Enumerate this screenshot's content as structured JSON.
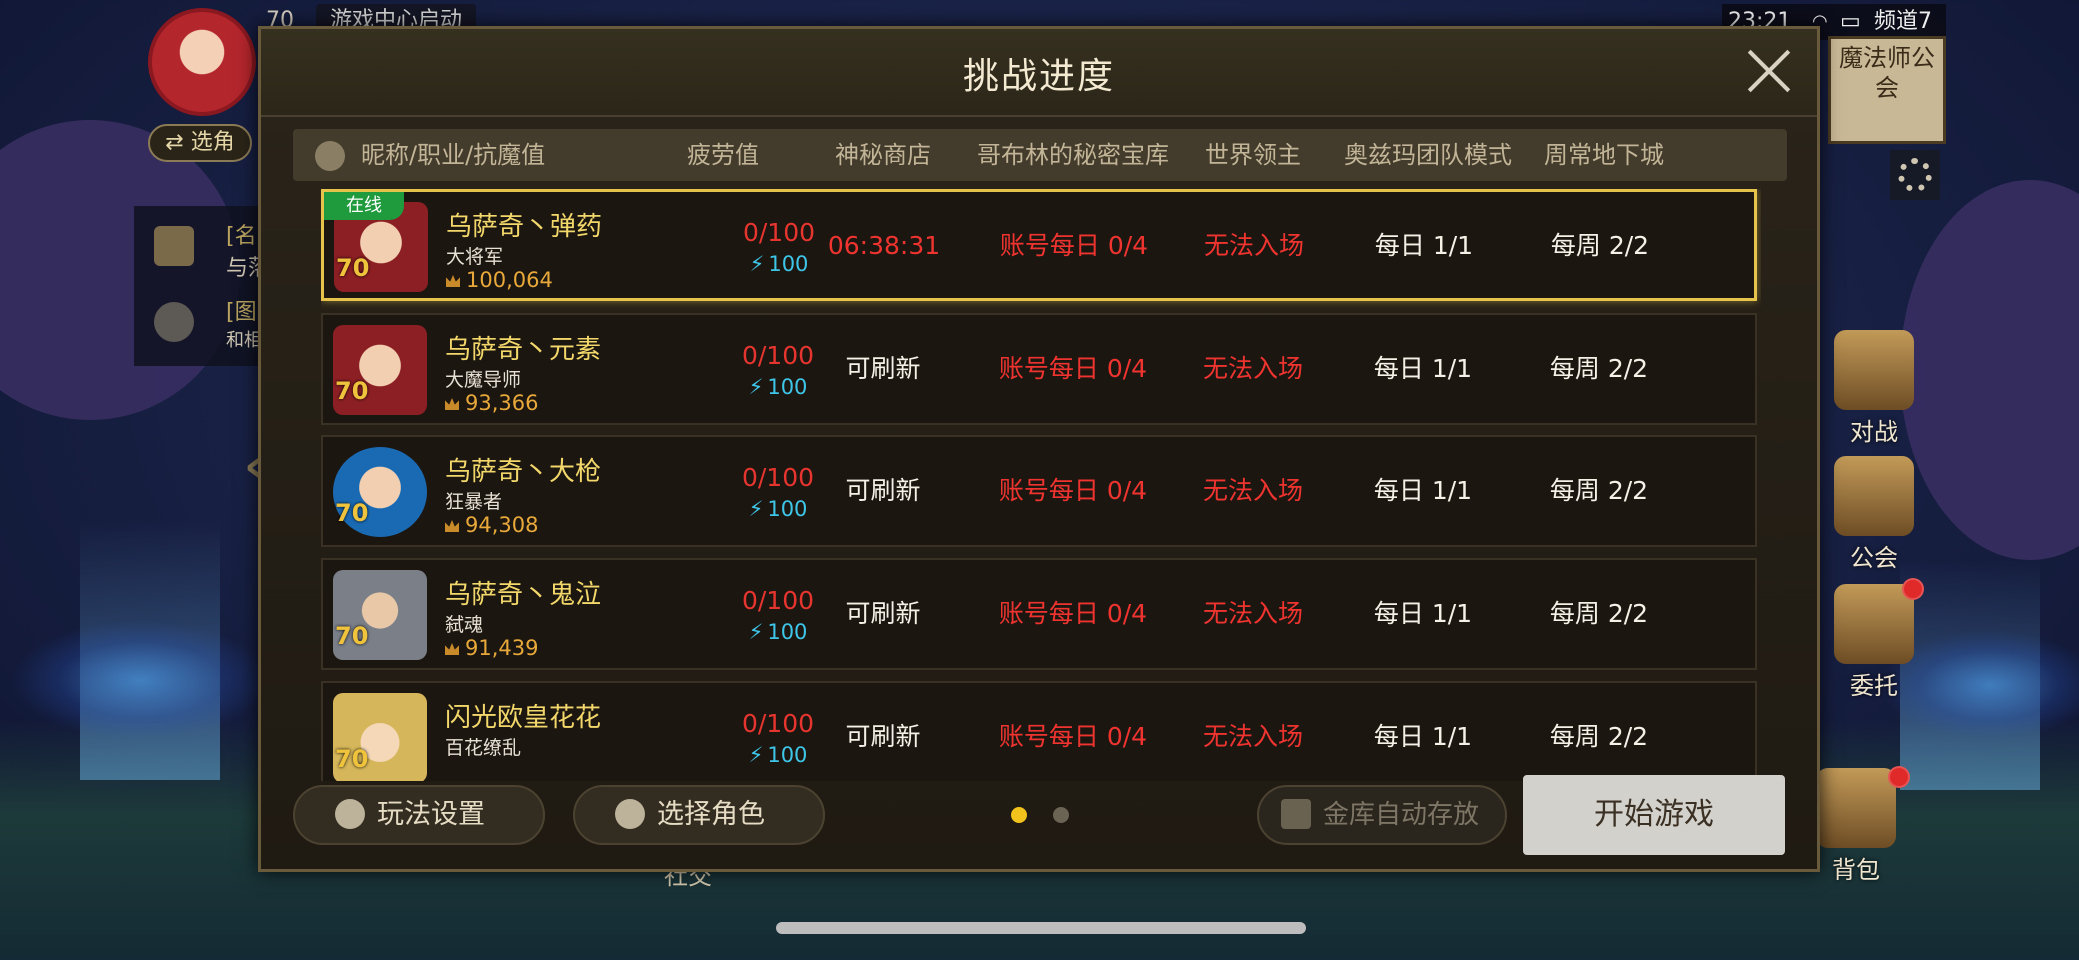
{
  "hud": {
    "level": "70",
    "game_center": "游戏中心启动",
    "switch_role": "⇄ 选角",
    "left_panel": [
      "[名",
      "与落",
      "[图",
      "和相"
    ],
    "clock": "23:21",
    "channel": "频道7",
    "guild_sign": "魔法师公会",
    "bottom_social": "社交"
  },
  "right_menu": [
    {
      "label": "对战",
      "icon": "battle-icon",
      "badge": false
    },
    {
      "label": "公会",
      "icon": "guild-icon",
      "badge": false
    },
    {
      "label": "委托",
      "icon": "commission-icon",
      "badge": true
    },
    {
      "label": "背包",
      "icon": "bag-icon",
      "badge": true
    }
  ],
  "dialog": {
    "title": "挑战进度",
    "columns": [
      "昵称/职业/抗魔值",
      "疲劳值",
      "神秘商店",
      "哥布林的秘密宝库",
      "世界领主",
      "奥兹玛团队模式",
      "周常地下城"
    ],
    "characters": [
      {
        "online": "在线",
        "name": "乌萨奇丶弹药",
        "job": "大将军",
        "power": "100,064",
        "level": "70",
        "fatigue": "0/100",
        "energy": "100",
        "shop": "06:38:31",
        "goblin": "账号每日 0/4",
        "lord": "无法入场",
        "ozma": "每日 1/1",
        "weekly": "每周 2/2",
        "selected": true
      },
      {
        "online": "",
        "name": "乌萨奇丶元素",
        "job": "大魔导师",
        "power": "93,366",
        "level": "70",
        "fatigue": "0/100",
        "energy": "100",
        "shop": "可刷新",
        "goblin": "账号每日 0/4",
        "lord": "无法入场",
        "ozma": "每日 1/1",
        "weekly": "每周 2/2",
        "selected": false
      },
      {
        "online": "",
        "name": "乌萨奇丶大枪",
        "job": "狂暴者",
        "power": "94,308",
        "level": "70",
        "fatigue": "0/100",
        "energy": "100",
        "shop": "可刷新",
        "goblin": "账号每日 0/4",
        "lord": "无法入场",
        "ozma": "每日 1/1",
        "weekly": "每周 2/2",
        "selected": false
      },
      {
        "online": "",
        "name": "乌萨奇丶鬼泣",
        "job": "弑魂",
        "power": "91,439",
        "level": "70",
        "fatigue": "0/100",
        "energy": "100",
        "shop": "可刷新",
        "goblin": "账号每日 0/4",
        "lord": "无法入场",
        "ozma": "每日 1/1",
        "weekly": "每周 2/2",
        "selected": false
      },
      {
        "online": "",
        "name": "闪光欧皇花花",
        "job": "百花缭乱",
        "power": "",
        "level": "70",
        "fatigue": "0/100",
        "energy": "100",
        "shop": "可刷新",
        "goblin": "账号每日 0/4",
        "lord": "无法入场",
        "ozma": "每日 1/1",
        "weekly": "每周 2/2",
        "selected": false
      }
    ],
    "footer": {
      "play_settings": "玩法设置",
      "select_role": "选择角色",
      "auto_store": "金库自动存放",
      "start_game": "开始游戏",
      "page_index": 1,
      "page_count": 2
    }
  },
  "colors": {
    "accent_gold": "#e6c44b",
    "name_gold": "#f2d76a",
    "status_red": "#ef3430",
    "energy_cyan": "#3ec6e8",
    "online_green": "#1f9a3c"
  }
}
